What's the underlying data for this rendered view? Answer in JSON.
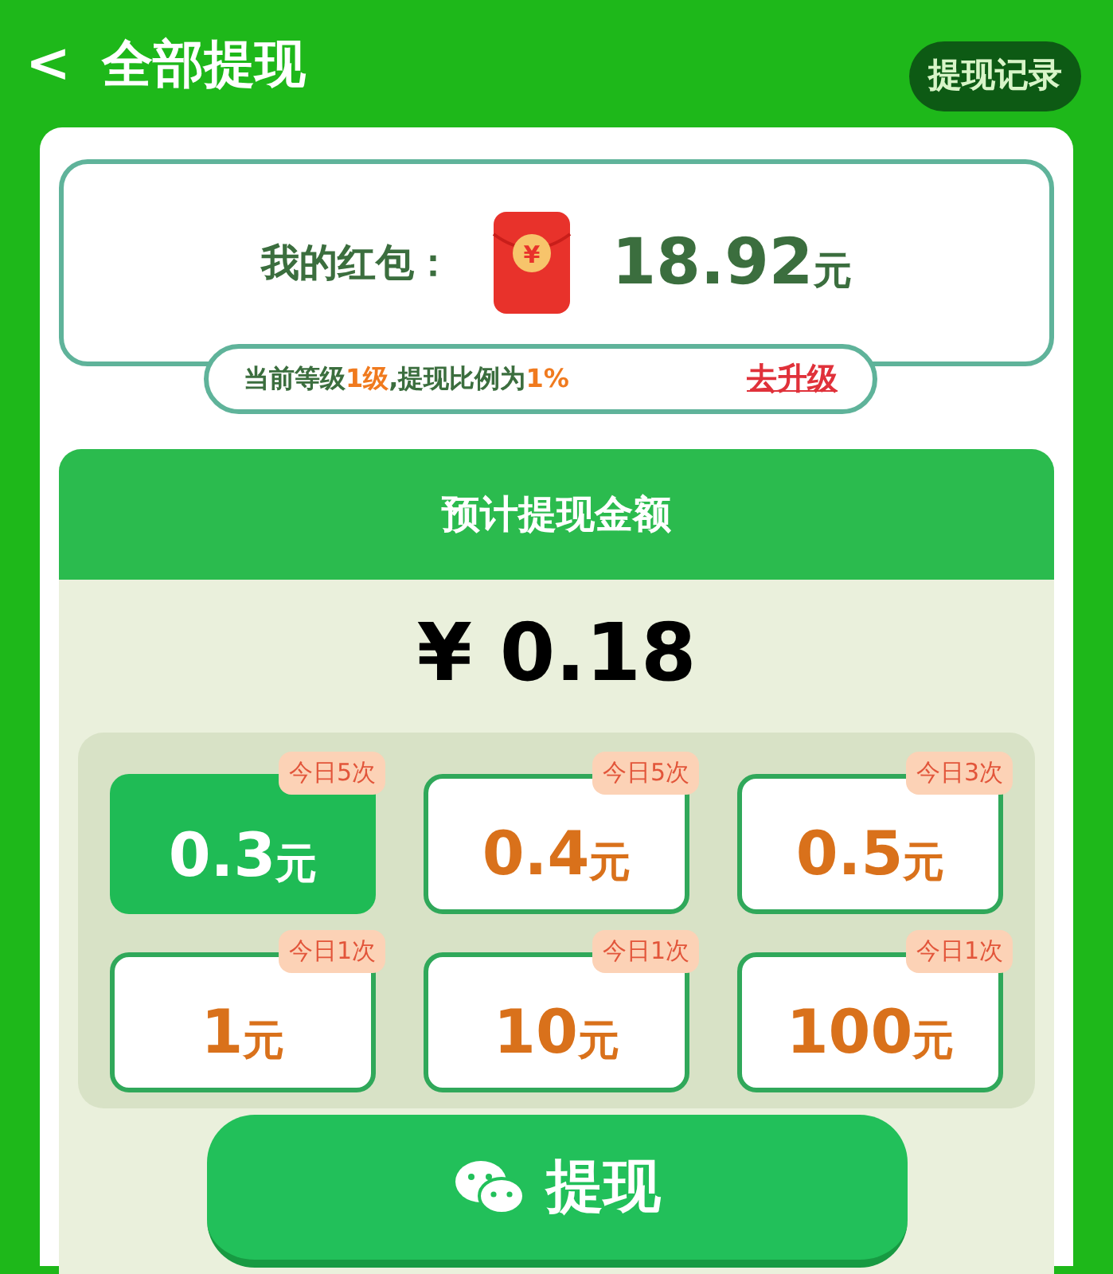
{
  "header": {
    "back": "<",
    "title": "全部提现",
    "history_button": "提现记录"
  },
  "wallet": {
    "label": "我的红包：",
    "envelope_symbol": "¥",
    "amount": "18.92",
    "unit": "元"
  },
  "level_info": {
    "segments": [
      {
        "text": "当前等级",
        "highlight": false
      },
      {
        "text": "1级",
        "highlight": true
      },
      {
        "text": ",提现比例为",
        "highlight": false
      },
      {
        "text": "1%",
        "highlight": true
      }
    ],
    "upgrade_link": "去升级"
  },
  "estimate": {
    "title": "预计提现金额",
    "amount": "¥ 0.18"
  },
  "options": [
    {
      "amount": "0.3",
      "unit": "元",
      "badge": "今日5次",
      "selected": true
    },
    {
      "amount": "0.4",
      "unit": "元",
      "badge": "今日5次",
      "selected": false
    },
    {
      "amount": "0.5",
      "unit": "元",
      "badge": "今日3次",
      "selected": false
    },
    {
      "amount": "1",
      "unit": "元",
      "badge": "今日1次",
      "selected": false
    },
    {
      "amount": "10",
      "unit": "元",
      "badge": "今日1次",
      "selected": false
    },
    {
      "amount": "100",
      "unit": "元",
      "badge": "今日1次",
      "selected": false
    }
  ],
  "withdraw_button": "提现"
}
